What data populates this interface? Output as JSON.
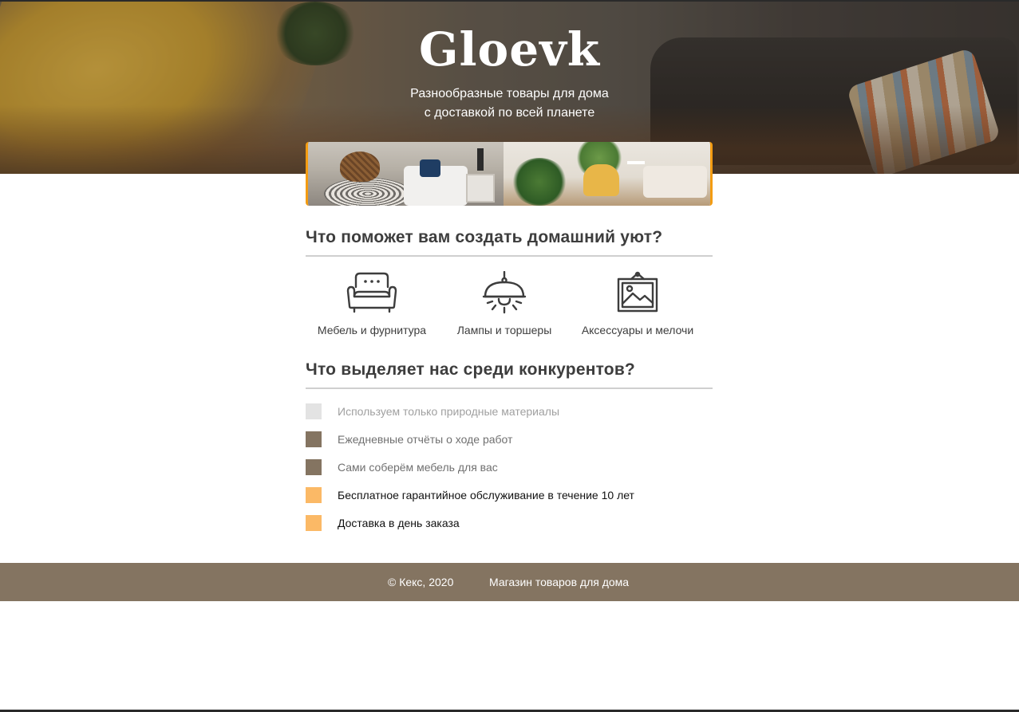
{
  "header": {
    "title": "Gloevk",
    "subtitle_line1": "Разнообразные товары для дома",
    "subtitle_line2": "с доставкой по всей планете"
  },
  "sections": {
    "categories_heading": "Что поможет вам создать домашний уют?",
    "advantages_heading": "Что выделяет нас среди конкурентов?"
  },
  "categories": [
    {
      "label": "Мебель и фурнитура",
      "icon": "sofa-icon"
    },
    {
      "label": "Лампы и торшеры",
      "icon": "lamp-icon"
    },
    {
      "label": "Аксессуары и мелочи",
      "icon": "picture-frame-icon"
    }
  ],
  "advantages": [
    {
      "text": "Используем только природные материалы",
      "marker_color": "#e3e3e3",
      "text_color": "#a0a0a0"
    },
    {
      "text": "Ежедневные отчёты о ходе работ",
      "marker_color": "#847461",
      "text_color": "#707070"
    },
    {
      "text": "Сами соберём мебель для вас",
      "marker_color": "#847461",
      "text_color": "#707070"
    },
    {
      "text": "Бесплатное гарантийное обслуживание в течение 10 лет",
      "marker_color": "#fbb966",
      "text_color": "#111111"
    },
    {
      "text": "Доставка в день заказа",
      "marker_color": "#fbb966",
      "text_color": "#111111"
    }
  ],
  "footer": {
    "copyright": "© Кекс, 2020",
    "link": "Магазин товаров для дома"
  },
  "colors": {
    "accent": "#f39c12",
    "footer_bg": "#847461",
    "heading_text": "#3d3d3d"
  }
}
